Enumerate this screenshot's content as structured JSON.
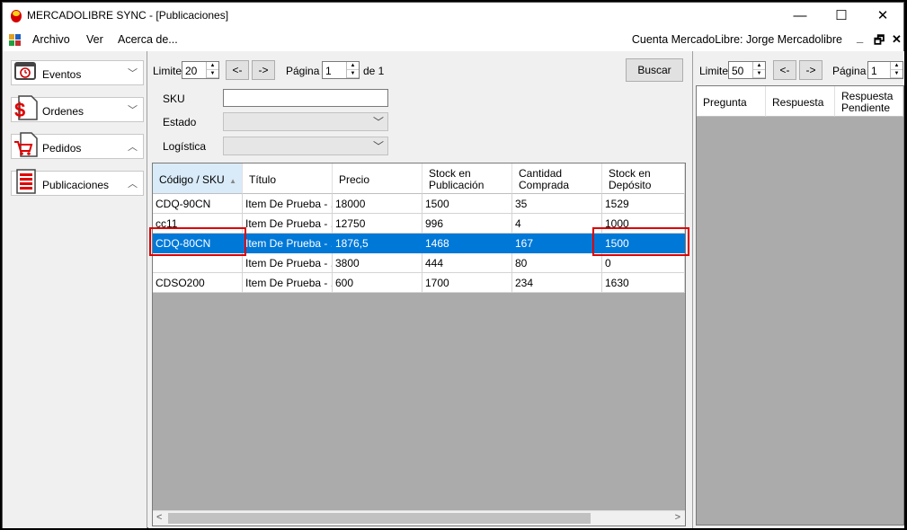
{
  "window": {
    "title": "MERCADOLIBRE SYNC - [Publicaciones]",
    "minimize": "—",
    "maximize": "☐",
    "close": "✕"
  },
  "menu": {
    "items": [
      "Archivo",
      "Ver",
      "Acerca de..."
    ],
    "account": "Cuenta MercadoLibre: Jorge Mercadolibre",
    "mdi_min": "_",
    "mdi_restore": "🗗",
    "mdi_close": "✕"
  },
  "sidebar": {
    "items": [
      {
        "label": "Eventos",
        "chevron": "﹀"
      },
      {
        "label": "Ordenes",
        "chevron": "﹀"
      },
      {
        "label": "Pedidos",
        "chevron": "︿"
      },
      {
        "label": "Publicaciones",
        "chevron": "︿"
      }
    ]
  },
  "pager": {
    "limit_label": "Limite",
    "limit_value": "20",
    "prev": "<-",
    "next": "->",
    "page_label": "Página",
    "page_value": "1",
    "of_label": "de 1",
    "search_button": "Buscar"
  },
  "filters": {
    "sku_label": "SKU",
    "sku_value": "",
    "estado_label": "Estado",
    "logistica_label": "Logística"
  },
  "table": {
    "headers": [
      "Código / SKU",
      "Título",
      "Precio",
      "Stock en\nPublicación",
      "Cantidad\nComprada",
      "Stock en\nDepósito"
    ],
    "sort_indicator": "▲",
    "rows": [
      [
        "CDQ-90CN",
        "Item De Prueba - ...",
        "18000",
        "1500",
        "35",
        "1529"
      ],
      [
        "cc11",
        "Item De Prueba - ...",
        "12750",
        "996",
        "4",
        "1000"
      ],
      [
        "CDQ-80CN",
        "Item De Prueba - ...",
        "1876,5",
        "1468",
        "167",
        "1500"
      ],
      [
        "",
        "Item De Prueba - ...",
        "3800",
        "444",
        "80",
        "0"
      ],
      [
        "CDSO200",
        "Item De Prueba - ...",
        "600",
        "1700",
        "234",
        "1630"
      ]
    ],
    "selected_row": 2,
    "scroll_left": "<",
    "scroll_right": ">"
  },
  "questions": {
    "limit_label": "Limite",
    "limit_value": "50",
    "prev": "<-",
    "next": "->",
    "page_label": "Página",
    "page_value": "1",
    "headers": [
      "Pregunta",
      "Respuesta",
      "Respuesta\nPendiente"
    ]
  },
  "colors": {
    "selection": "#0078d7",
    "highlight": "#dd0000",
    "grid_background": "#ababab"
  }
}
